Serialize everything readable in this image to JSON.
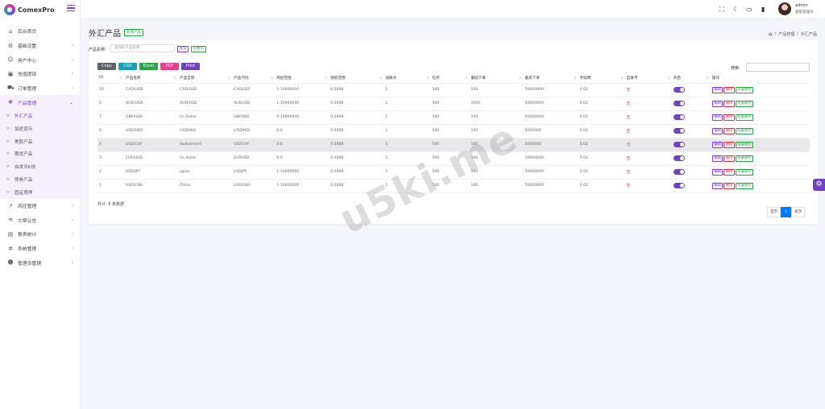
{
  "brand": {
    "name": "ComexPro"
  },
  "sidebar": {
    "items": [
      {
        "label": "后台首页",
        "icon": "home-icon",
        "glyph": "⌂"
      },
      {
        "label": "基础设置",
        "icon": "settings-icon",
        "glyph": "⚙"
      },
      {
        "label": "用户中心",
        "icon": "user-icon",
        "glyph": "☺"
      },
      {
        "label": "充值提现",
        "icon": "wallet-icon",
        "glyph": "▣"
      },
      {
        "label": "订单管理",
        "icon": "cart-icon",
        "glyph": "⛟"
      },
      {
        "label": "产品管理",
        "icon": "products-icon",
        "glyph": "❖"
      }
    ],
    "subitems": [
      "外汇产品",
      "加密货币",
      "美股产品",
      "期货产品",
      "自发币K线",
      "债券产品",
      "固定质押"
    ],
    "items2": [
      {
        "label": "风控管理",
        "icon": "chart-icon",
        "glyph": "↗"
      },
      {
        "label": "文章公告",
        "icon": "layers-icon",
        "glyph": "≋"
      },
      {
        "label": "报表统计",
        "icon": "report-icon",
        "glyph": "▤"
      },
      {
        "label": "系统管理",
        "icon": "system-icon",
        "glyph": "✲"
      },
      {
        "label": "管理员管理",
        "icon": "admin-icon",
        "glyph": "☻"
      }
    ]
  },
  "header": {
    "username": "admin",
    "role": "超级管理员"
  },
  "page": {
    "title": "外汇产品",
    "add_label": "新增产品",
    "breadcrumb": [
      "产品管理",
      "外汇产品"
    ]
  },
  "filter": {
    "label": "产品名称:",
    "placeholder": "查询的产品名称",
    "query_label": "查询",
    "reset_label": "初始化"
  },
  "export": {
    "buttons": [
      "Copy",
      "CSV",
      "Excel",
      "PDF",
      "Print"
    ]
  },
  "search": {
    "label": "搜索:"
  },
  "table": {
    "columns": [
      "ID",
      "产品名称",
      "产品全称",
      "产品代码",
      "风控范围",
      "随机范围",
      "涨跌点",
      "杠杆",
      "最低下单",
      "最高下单",
      "手续费",
      "自发币",
      "开启",
      "操作"
    ],
    "rows": [
      {
        "id": "10",
        "name": "CAD/USD",
        "full": "CAD/USD",
        "code": "CADUSD",
        "risk": "1-10000000",
        "rand": "0.0008",
        "pt": "1",
        "lev": "500",
        "min": "100",
        "max": "50000000",
        "fee": "0.02",
        "self": "否"
      },
      {
        "id": "5",
        "name": "AUD/USD",
        "full": "AUD/USD",
        "code": "AUDUSD",
        "risk": "1-10000000",
        "rand": "0.0008",
        "pt": "1",
        "lev": "500",
        "min": "1000",
        "max": "50000000",
        "fee": "0.02",
        "self": "否"
      },
      {
        "id": "7",
        "name": "GBP/USD",
        "full": "Us Dollar",
        "code": "GBPUSD",
        "risk": "0-10000000",
        "rand": "0.0008",
        "pt": "1",
        "lev": "500",
        "min": "100",
        "max": "50000000",
        "fee": "0.02",
        "self": "否"
      },
      {
        "id": "5",
        "name": "USD/HKD",
        "full": "USDHKD",
        "code": "USDHKD",
        "risk": "0-0",
        "rand": "0.0008",
        "pt": "1",
        "lev": "500",
        "min": "100",
        "max": "5000000",
        "fee": "0.02",
        "self": "否"
      },
      {
        "id": "4",
        "name": "USD/CHF",
        "full": "Switzerland",
        "code": "USDCHF",
        "risk": "0-0",
        "rand": "0.0008",
        "pt": "1",
        "lev": "500",
        "min": "100",
        "max": "5000000",
        "fee": "0.02",
        "self": "否"
      },
      {
        "id": "3",
        "name": "EUR/USD",
        "full": "Us dollar",
        "code": "EURUSD",
        "risk": "0-0",
        "rand": "0.0008",
        "pt": "1",
        "lev": "500",
        "min": "100",
        "max": "10000000",
        "fee": "0.02",
        "self": "否"
      },
      {
        "id": "2",
        "name": "USD/JPY",
        "full": "japan",
        "code": "USDJPY",
        "risk": "1-10000000",
        "rand": "0.0008",
        "pt": "1",
        "lev": "500",
        "min": "100",
        "max": "50000000",
        "fee": "0.02",
        "self": "否"
      },
      {
        "id": "1",
        "name": "USD/CNH",
        "full": "China",
        "code": "USDCNH",
        "risk": "1-10000000",
        "rand": "0.0008",
        "pt": "1",
        "lev": "500",
        "min": "100",
        "max": "50000000",
        "fee": "0.02",
        "self": "否"
      }
    ],
    "actions": [
      "编辑",
      "删除",
      "配置期控"
    ]
  },
  "footer": {
    "total": "共计: 8 条数据"
  },
  "pagination": {
    "prev": "首页",
    "current": "1",
    "next": "尾页"
  },
  "watermark": "u5ki.me",
  "colors": {
    "accent": "#7b3fe4",
    "copy": "#5a6268",
    "csv": "#17a2b8",
    "excel": "#28a745",
    "pdf": "#e83e8c",
    "print": "#6f42c1",
    "danger": "#dc3545"
  }
}
